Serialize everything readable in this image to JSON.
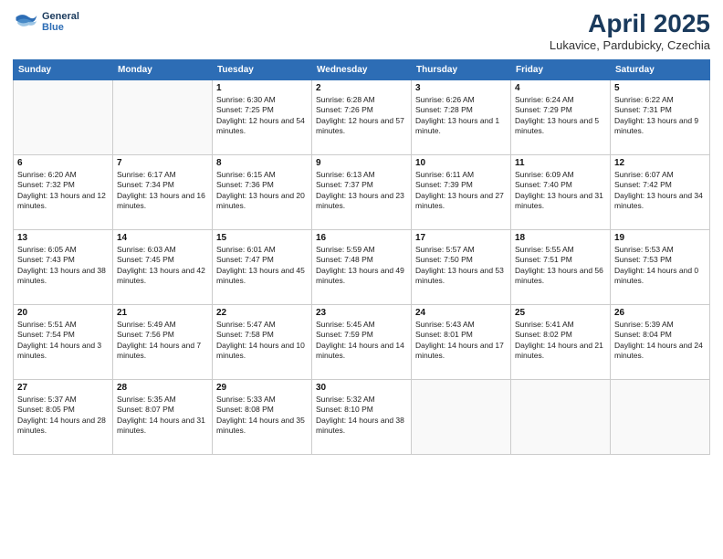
{
  "header": {
    "logo_line1": "General",
    "logo_line2": "Blue",
    "month": "April 2025",
    "location": "Lukavice, Pardubicky, Czechia"
  },
  "weekdays": [
    "Sunday",
    "Monday",
    "Tuesday",
    "Wednesday",
    "Thursday",
    "Friday",
    "Saturday"
  ],
  "weeks": [
    [
      {
        "day": null
      },
      {
        "day": null
      },
      {
        "day": "1",
        "sunrise": "Sunrise: 6:30 AM",
        "sunset": "Sunset: 7:25 PM",
        "daylight": "Daylight: 12 hours and 54 minutes."
      },
      {
        "day": "2",
        "sunrise": "Sunrise: 6:28 AM",
        "sunset": "Sunset: 7:26 PM",
        "daylight": "Daylight: 12 hours and 57 minutes."
      },
      {
        "day": "3",
        "sunrise": "Sunrise: 6:26 AM",
        "sunset": "Sunset: 7:28 PM",
        "daylight": "Daylight: 13 hours and 1 minute."
      },
      {
        "day": "4",
        "sunrise": "Sunrise: 6:24 AM",
        "sunset": "Sunset: 7:29 PM",
        "daylight": "Daylight: 13 hours and 5 minutes."
      },
      {
        "day": "5",
        "sunrise": "Sunrise: 6:22 AM",
        "sunset": "Sunset: 7:31 PM",
        "daylight": "Daylight: 13 hours and 9 minutes."
      }
    ],
    [
      {
        "day": "6",
        "sunrise": "Sunrise: 6:20 AM",
        "sunset": "Sunset: 7:32 PM",
        "daylight": "Daylight: 13 hours and 12 minutes."
      },
      {
        "day": "7",
        "sunrise": "Sunrise: 6:17 AM",
        "sunset": "Sunset: 7:34 PM",
        "daylight": "Daylight: 13 hours and 16 minutes."
      },
      {
        "day": "8",
        "sunrise": "Sunrise: 6:15 AM",
        "sunset": "Sunset: 7:36 PM",
        "daylight": "Daylight: 13 hours and 20 minutes."
      },
      {
        "day": "9",
        "sunrise": "Sunrise: 6:13 AM",
        "sunset": "Sunset: 7:37 PM",
        "daylight": "Daylight: 13 hours and 23 minutes."
      },
      {
        "day": "10",
        "sunrise": "Sunrise: 6:11 AM",
        "sunset": "Sunset: 7:39 PM",
        "daylight": "Daylight: 13 hours and 27 minutes."
      },
      {
        "day": "11",
        "sunrise": "Sunrise: 6:09 AM",
        "sunset": "Sunset: 7:40 PM",
        "daylight": "Daylight: 13 hours and 31 minutes."
      },
      {
        "day": "12",
        "sunrise": "Sunrise: 6:07 AM",
        "sunset": "Sunset: 7:42 PM",
        "daylight": "Daylight: 13 hours and 34 minutes."
      }
    ],
    [
      {
        "day": "13",
        "sunrise": "Sunrise: 6:05 AM",
        "sunset": "Sunset: 7:43 PM",
        "daylight": "Daylight: 13 hours and 38 minutes."
      },
      {
        "day": "14",
        "sunrise": "Sunrise: 6:03 AM",
        "sunset": "Sunset: 7:45 PM",
        "daylight": "Daylight: 13 hours and 42 minutes."
      },
      {
        "day": "15",
        "sunrise": "Sunrise: 6:01 AM",
        "sunset": "Sunset: 7:47 PM",
        "daylight": "Daylight: 13 hours and 45 minutes."
      },
      {
        "day": "16",
        "sunrise": "Sunrise: 5:59 AM",
        "sunset": "Sunset: 7:48 PM",
        "daylight": "Daylight: 13 hours and 49 minutes."
      },
      {
        "day": "17",
        "sunrise": "Sunrise: 5:57 AM",
        "sunset": "Sunset: 7:50 PM",
        "daylight": "Daylight: 13 hours and 53 minutes."
      },
      {
        "day": "18",
        "sunrise": "Sunrise: 5:55 AM",
        "sunset": "Sunset: 7:51 PM",
        "daylight": "Daylight: 13 hours and 56 minutes."
      },
      {
        "day": "19",
        "sunrise": "Sunrise: 5:53 AM",
        "sunset": "Sunset: 7:53 PM",
        "daylight": "Daylight: 14 hours and 0 minutes."
      }
    ],
    [
      {
        "day": "20",
        "sunrise": "Sunrise: 5:51 AM",
        "sunset": "Sunset: 7:54 PM",
        "daylight": "Daylight: 14 hours and 3 minutes."
      },
      {
        "day": "21",
        "sunrise": "Sunrise: 5:49 AM",
        "sunset": "Sunset: 7:56 PM",
        "daylight": "Daylight: 14 hours and 7 minutes."
      },
      {
        "day": "22",
        "sunrise": "Sunrise: 5:47 AM",
        "sunset": "Sunset: 7:58 PM",
        "daylight": "Daylight: 14 hours and 10 minutes."
      },
      {
        "day": "23",
        "sunrise": "Sunrise: 5:45 AM",
        "sunset": "Sunset: 7:59 PM",
        "daylight": "Daylight: 14 hours and 14 minutes."
      },
      {
        "day": "24",
        "sunrise": "Sunrise: 5:43 AM",
        "sunset": "Sunset: 8:01 PM",
        "daylight": "Daylight: 14 hours and 17 minutes."
      },
      {
        "day": "25",
        "sunrise": "Sunrise: 5:41 AM",
        "sunset": "Sunset: 8:02 PM",
        "daylight": "Daylight: 14 hours and 21 minutes."
      },
      {
        "day": "26",
        "sunrise": "Sunrise: 5:39 AM",
        "sunset": "Sunset: 8:04 PM",
        "daylight": "Daylight: 14 hours and 24 minutes."
      }
    ],
    [
      {
        "day": "27",
        "sunrise": "Sunrise: 5:37 AM",
        "sunset": "Sunset: 8:05 PM",
        "daylight": "Daylight: 14 hours and 28 minutes."
      },
      {
        "day": "28",
        "sunrise": "Sunrise: 5:35 AM",
        "sunset": "Sunset: 8:07 PM",
        "daylight": "Daylight: 14 hours and 31 minutes."
      },
      {
        "day": "29",
        "sunrise": "Sunrise: 5:33 AM",
        "sunset": "Sunset: 8:08 PM",
        "daylight": "Daylight: 14 hours and 35 minutes."
      },
      {
        "day": "30",
        "sunrise": "Sunrise: 5:32 AM",
        "sunset": "Sunset: 8:10 PM",
        "daylight": "Daylight: 14 hours and 38 minutes."
      },
      {
        "day": null
      },
      {
        "day": null
      },
      {
        "day": null
      }
    ]
  ]
}
